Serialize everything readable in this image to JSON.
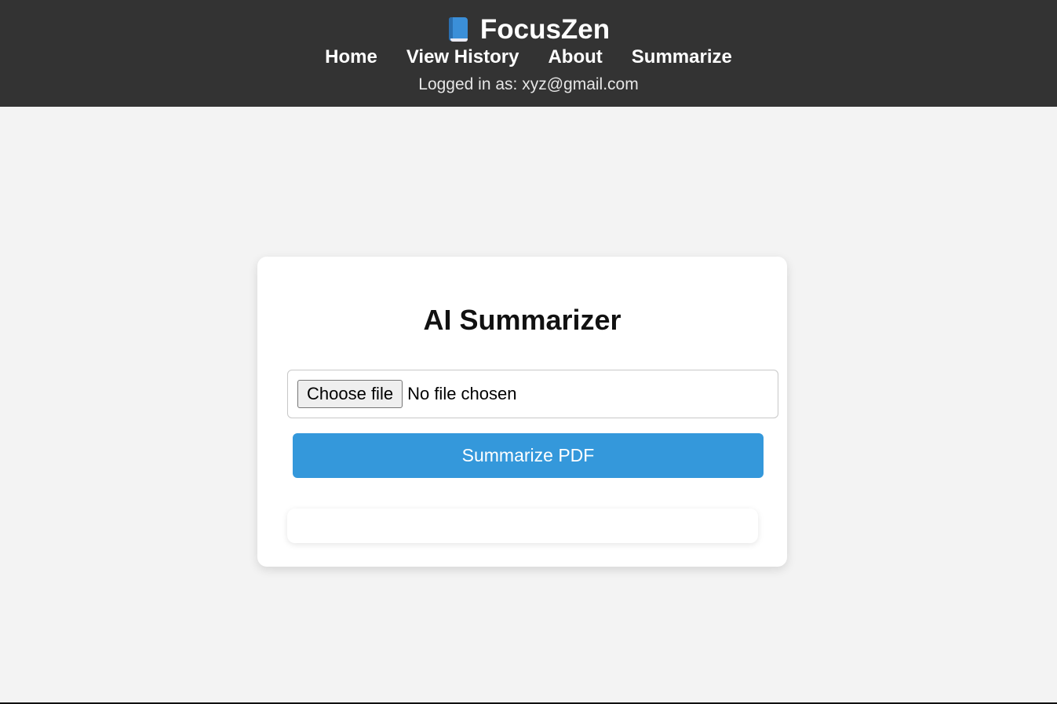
{
  "header": {
    "brand_icon": "book-icon",
    "brand_name": "FocusZen",
    "nav": [
      {
        "label": "Home"
      },
      {
        "label": "View History"
      },
      {
        "label": "About"
      },
      {
        "label": "Summarize"
      }
    ],
    "logged_in_text": "Logged in as: xyz@gmail.com"
  },
  "card": {
    "title": "AI Summarizer",
    "file_input": {
      "button_label": "Choose file",
      "status": "No file chosen"
    },
    "submit_label": "Summarize PDF",
    "result_text": ""
  },
  "colors": {
    "header_bg": "#333333",
    "page_bg": "#f3f3f3",
    "accent": "#3498db"
  }
}
